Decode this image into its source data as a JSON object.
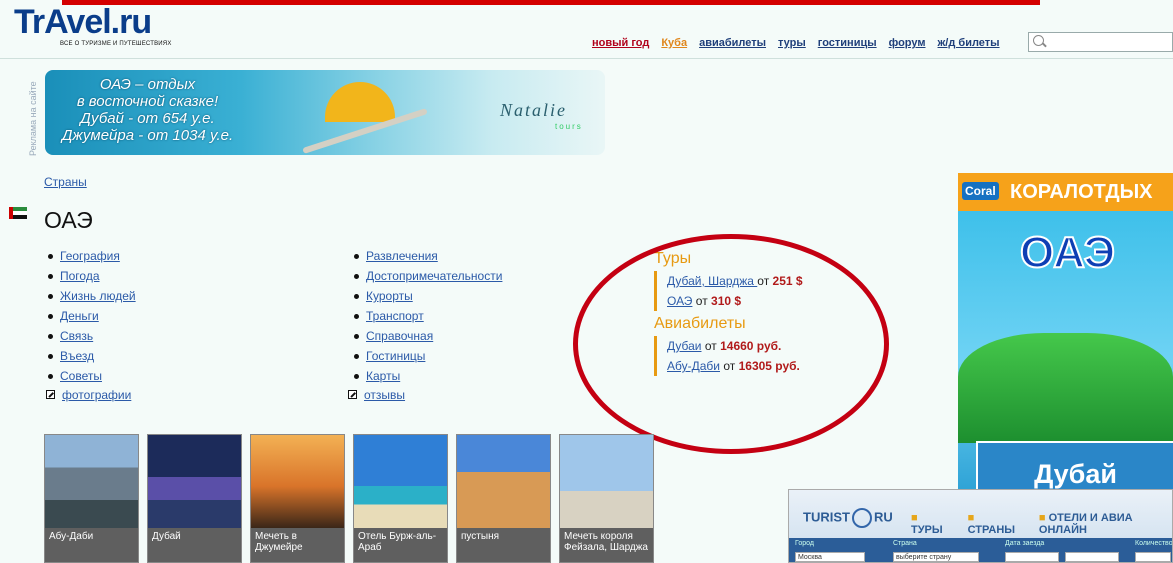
{
  "header": {
    "logo": "TrAvel.ru",
    "tagline": "ВСЕ О ТУРИЗМЕ И ПУТЕШЕСТВИЯХ",
    "nav": [
      "новый год",
      "Куба",
      "авиабилеты",
      "туры",
      "гостиницы",
      "форум",
      "ж/д билеты"
    ],
    "search_placeholder": ""
  },
  "banner": {
    "side_label": "Реклама на сайте",
    "line1": "ОАЭ – отдых",
    "line2": "в восточной сказке!",
    "line3": "Дубай - от 654 у.е.",
    "line4": "Джумейра - от 1034 у.е.",
    "brand": "Natalie",
    "brand_sub": "tours"
  },
  "breadcrumb": "Страны",
  "page_title": "ОАЭ",
  "col1": [
    "География",
    "Погода",
    "Жизнь людей",
    "Деньги",
    "Связь",
    "Въезд",
    "Советы"
  ],
  "col1_ext": "фотографии",
  "col2": [
    "Развлечения",
    "Достопримечательности",
    "Курорты",
    "Транспорт",
    "Справочная",
    "Гостиницы",
    "Карты"
  ],
  "col2_ext": "отзывы",
  "tours": {
    "title": "Туры",
    "items": [
      {
        "link": "Дубай, Шарджа ",
        "from": "от",
        "price": "251 $"
      },
      {
        "link": "ОАЭ",
        "from": "от",
        "price": "310 $"
      }
    ]
  },
  "flights": {
    "title": "Авиабилеты",
    "items": [
      {
        "link": "Дубаи",
        "from": "от",
        "price": "14660 руб."
      },
      {
        "link": "Абу-Даби",
        "from": "от",
        "price": "16305 руб."
      }
    ]
  },
  "photos": [
    {
      "caption": "Абу-Даби"
    },
    {
      "caption": "Дубай"
    },
    {
      "caption": "Мечеть в Джумейре"
    },
    {
      "caption": "Отель Бурж-аль-Араб"
    },
    {
      "caption": "пустыня"
    },
    {
      "caption": "Мечеть короля Фейзала, Шарджа"
    }
  ],
  "right_ad": {
    "logo": "Coral",
    "headline": "КОРАЛОТДЫХ",
    "country": "ОАЭ",
    "button": "Дубай"
  },
  "widget": {
    "logo_left": "TURIST",
    "logo_right": "RU",
    "tabs": [
      "ТУРЫ",
      "СТРАНЫ",
      "ОТЕЛИ И АВИА ОНЛАЙН"
    ],
    "labels": [
      "Город",
      "Страна",
      "Дата заезда",
      "Количество"
    ],
    "city_value": "Москва",
    "country_value": "выберите страну"
  }
}
